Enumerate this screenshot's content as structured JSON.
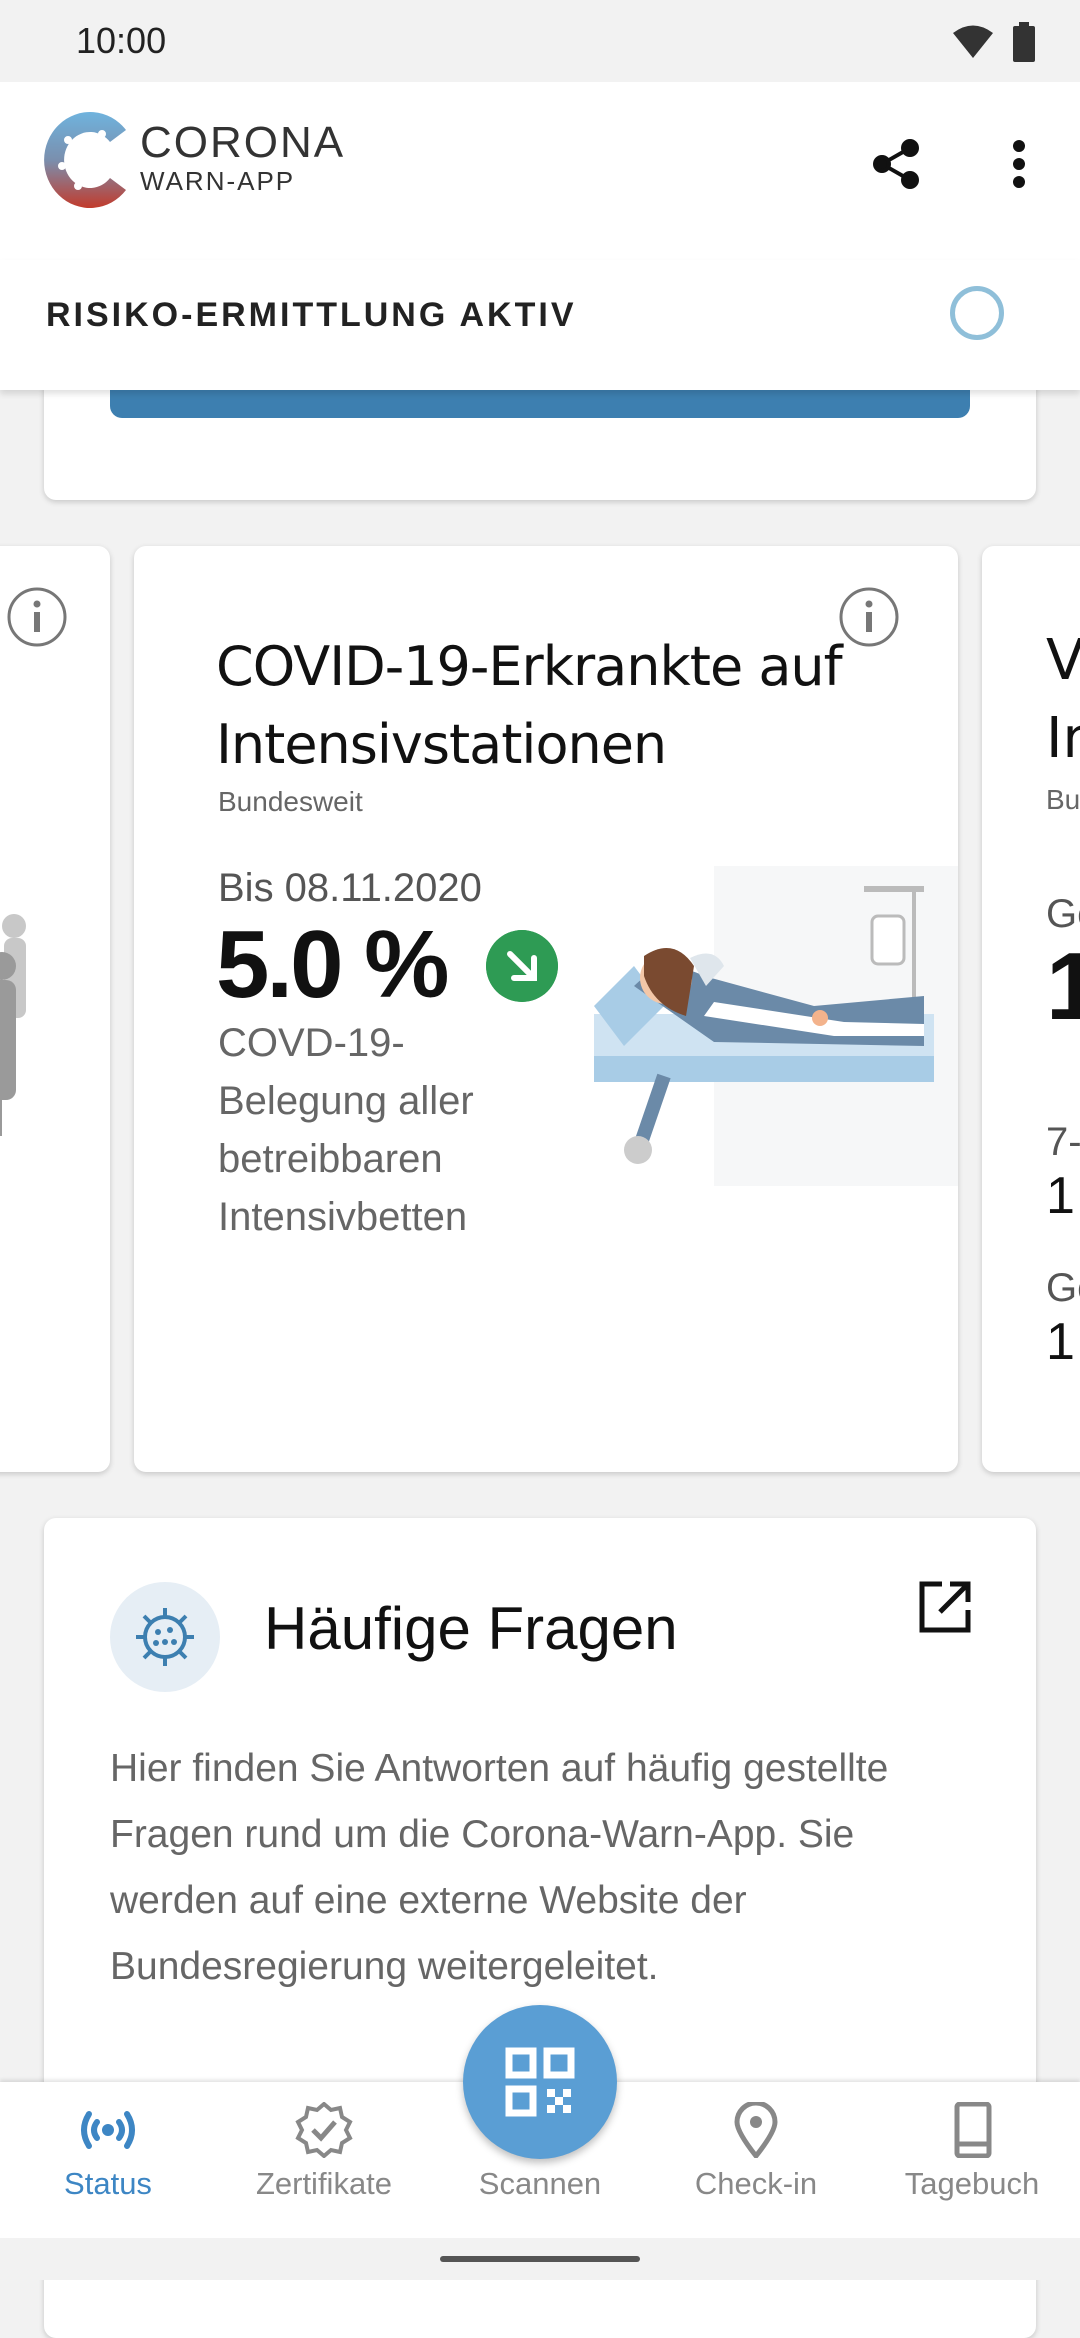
{
  "status_bar": {
    "time": "10:00"
  },
  "app": {
    "brand_line1": "CORONA",
    "brand_line2": "WARN-APP"
  },
  "risk": {
    "label": "RISIKO-ERMITTLUNG AKTIV"
  },
  "statistics": {
    "main_card": {
      "title": "COVID-19-Erkrankte auf Intensivstationen",
      "region": "Bundesweit",
      "date": "Bis 08.11.2020",
      "value": "5.0 %",
      "trend": "down",
      "description": "COVD-19-Belegung aller betreibbaren Intensivbetten"
    },
    "right_peek": {
      "title_line1": "V",
      "title_line2": "In",
      "region": "Bu",
      "label1": "Ge",
      "value1": "1",
      "label2": "7-",
      "value2": "1",
      "label3": "Ge",
      "value3": "1"
    }
  },
  "faq": {
    "title": "Häufige Fragen",
    "text": "Hier finden Sie Antworten auf häufig gestellte Fragen rund um die Corona-Warn-App. Sie werden auf eine externe Website der Bundesregierung weitergeleitet."
  },
  "bottom_nav": {
    "items": [
      {
        "label": "Status",
        "icon": "broadcast-icon",
        "active": true
      },
      {
        "label": "Zertifikate",
        "icon": "certificate-icon"
      },
      {
        "label": "Scannen",
        "icon": "qr-code-icon"
      },
      {
        "label": "Check-in",
        "icon": "location-pin-icon"
      },
      {
        "label": "Tagebuch",
        "icon": "book-icon"
      }
    ]
  },
  "colors": {
    "accent": "#3d86c4",
    "trend_down": "#2e9b54",
    "risk_ring": "#8fbfd9"
  }
}
